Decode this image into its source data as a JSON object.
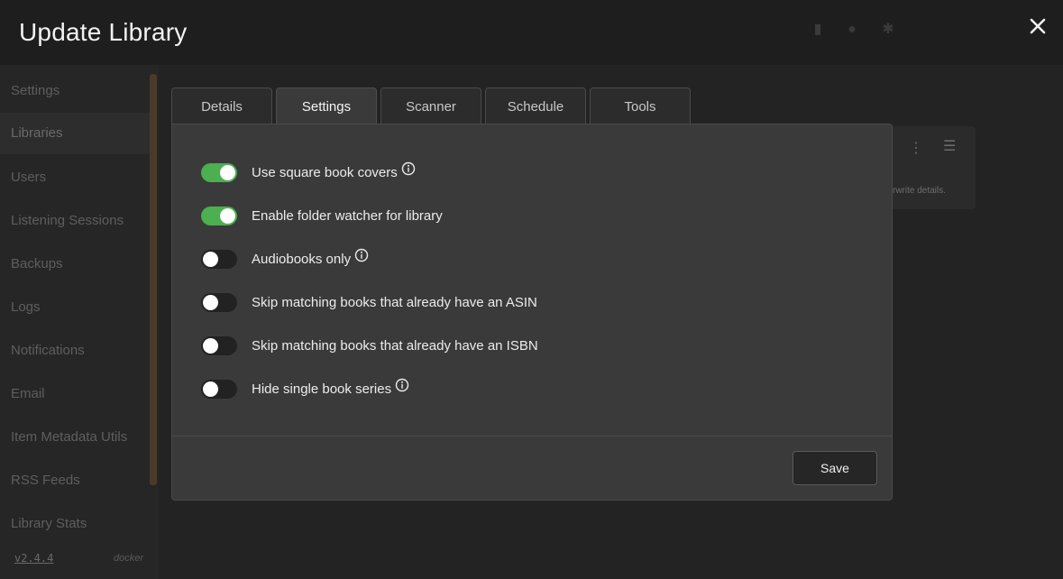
{
  "modal": {
    "title": "Update Library",
    "tabs": [
      {
        "label": "Details"
      },
      {
        "label": "Settings"
      },
      {
        "label": "Scanner"
      },
      {
        "label": "Schedule"
      },
      {
        "label": "Tools"
      }
    ],
    "active_tab": "Settings",
    "settings": [
      {
        "label": "Use square book covers",
        "enabled": true,
        "has_info": true
      },
      {
        "label": "Enable folder watcher for library",
        "enabled": true,
        "has_info": false
      },
      {
        "label": "Audiobooks only",
        "enabled": false,
        "has_info": true
      },
      {
        "label": "Skip matching books that already have an ASIN",
        "enabled": false,
        "has_info": false
      },
      {
        "label": "Skip matching books that already have an ISBN",
        "enabled": false,
        "has_info": false
      },
      {
        "label": "Hide single book series",
        "enabled": false,
        "has_info": true
      }
    ],
    "save_label": "Save"
  },
  "background": {
    "sidebar_items": [
      "Settings",
      "Libraries",
      "Users",
      "Listening Sessions",
      "Backups",
      "Logs",
      "Notifications",
      "Email",
      "Item Metadata Utils",
      "RSS Feeds",
      "Library Stats"
    ],
    "version": "v2.4.4",
    "environment": "docker",
    "card_snippet": "rwrite details."
  },
  "colors": {
    "toggle_on": "#4caf50",
    "panel_bg": "#3a3a3a",
    "page_bg": "#232323"
  },
  "icons": [
    "close-icon",
    "info-icon",
    "more-vertical-icon",
    "list-icon"
  ]
}
